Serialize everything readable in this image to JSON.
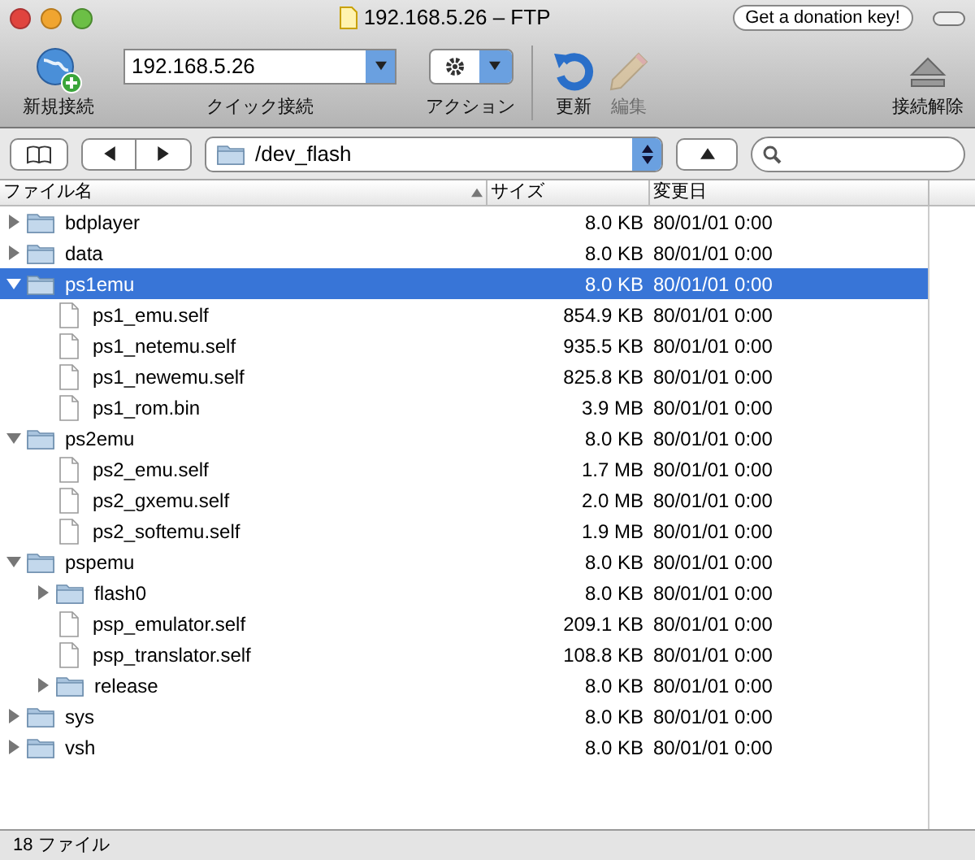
{
  "window": {
    "title": "192.168.5.26 – FTP",
    "donation_button": "Get a donation key!"
  },
  "toolbar": {
    "new_connection": {
      "label": "新規接続"
    },
    "quick_connect": {
      "value": "192.168.5.26",
      "label": "クイック接続"
    },
    "action": {
      "label": "アクション"
    },
    "refresh": {
      "label": "更新",
      "disabled": false
    },
    "edit": {
      "label": "編集",
      "disabled": true
    },
    "disconnect": {
      "label": "接続解除"
    }
  },
  "path_bar": {
    "path": "/dev_flash"
  },
  "table": {
    "columns": [
      {
        "label": "ファイル名",
        "sorted": true
      },
      {
        "label": "サイズ",
        "sorted": false
      },
      {
        "label": "変更日",
        "sorted": false
      }
    ],
    "rows": [
      {
        "name": "bdplayer",
        "kind": "folder",
        "expanded": false,
        "selected": false,
        "size": "8.0 KB",
        "date": "80/01/01 0:00"
      },
      {
        "name": "data",
        "kind": "folder",
        "expanded": false,
        "selected": false,
        "size": "8.0 KB",
        "date": "80/01/01 0:00"
      },
      {
        "name": "ps1emu",
        "kind": "folder",
        "expanded": true,
        "selected": true,
        "size": "8.0 KB",
        "date": "80/01/01 0:00",
        "children": [
          {
            "name": "ps1_emu.self",
            "kind": "file",
            "selected": false,
            "size": "854.9 KB",
            "date": "80/01/01 0:00"
          },
          {
            "name": "ps1_netemu.self",
            "kind": "file",
            "selected": false,
            "size": "935.5 KB",
            "date": "80/01/01 0:00"
          },
          {
            "name": "ps1_newemu.self",
            "kind": "file",
            "selected": false,
            "size": "825.8 KB",
            "date": "80/01/01 0:00"
          },
          {
            "name": "ps1_rom.bin",
            "kind": "file",
            "selected": false,
            "size": "3.9 MB",
            "date": "80/01/01 0:00"
          }
        ]
      },
      {
        "name": "ps2emu",
        "kind": "folder",
        "expanded": true,
        "selected": false,
        "size": "8.0 KB",
        "date": "80/01/01 0:00",
        "children": [
          {
            "name": "ps2_emu.self",
            "kind": "file",
            "selected": false,
            "size": "1.7 MB",
            "date": "80/01/01 0:00"
          },
          {
            "name": "ps2_gxemu.self",
            "kind": "file",
            "selected": false,
            "size": "2.0 MB",
            "date": "80/01/01 0:00"
          },
          {
            "name": "ps2_softemu.self",
            "kind": "file",
            "selected": false,
            "size": "1.9 MB",
            "date": "80/01/01 0:00"
          }
        ]
      },
      {
        "name": "pspemu",
        "kind": "folder",
        "expanded": true,
        "selected": false,
        "size": "8.0 KB",
        "date": "80/01/01 0:00",
        "children": [
          {
            "name": "flash0",
            "kind": "folder",
            "expanded": false,
            "selected": false,
            "size": "8.0 KB",
            "date": "80/01/01 0:00"
          },
          {
            "name": "psp_emulator.self",
            "kind": "file",
            "selected": false,
            "size": "209.1 KB",
            "date": "80/01/01 0:00"
          },
          {
            "name": "psp_translator.self",
            "kind": "file",
            "selected": false,
            "size": "108.8 KB",
            "date": "80/01/01 0:00"
          },
          {
            "name": "release",
            "kind": "folder",
            "expanded": false,
            "selected": false,
            "size": "8.0 KB",
            "date": "80/01/01 0:00"
          }
        ]
      },
      {
        "name": "sys",
        "kind": "folder",
        "expanded": false,
        "selected": false,
        "size": "8.0 KB",
        "date": "80/01/01 0:00"
      },
      {
        "name": "vsh",
        "kind": "folder",
        "expanded": false,
        "selected": false,
        "size": "8.0 KB",
        "date": "80/01/01 0:00"
      }
    ]
  },
  "status_bar": {
    "text": "18 ファイル"
  }
}
